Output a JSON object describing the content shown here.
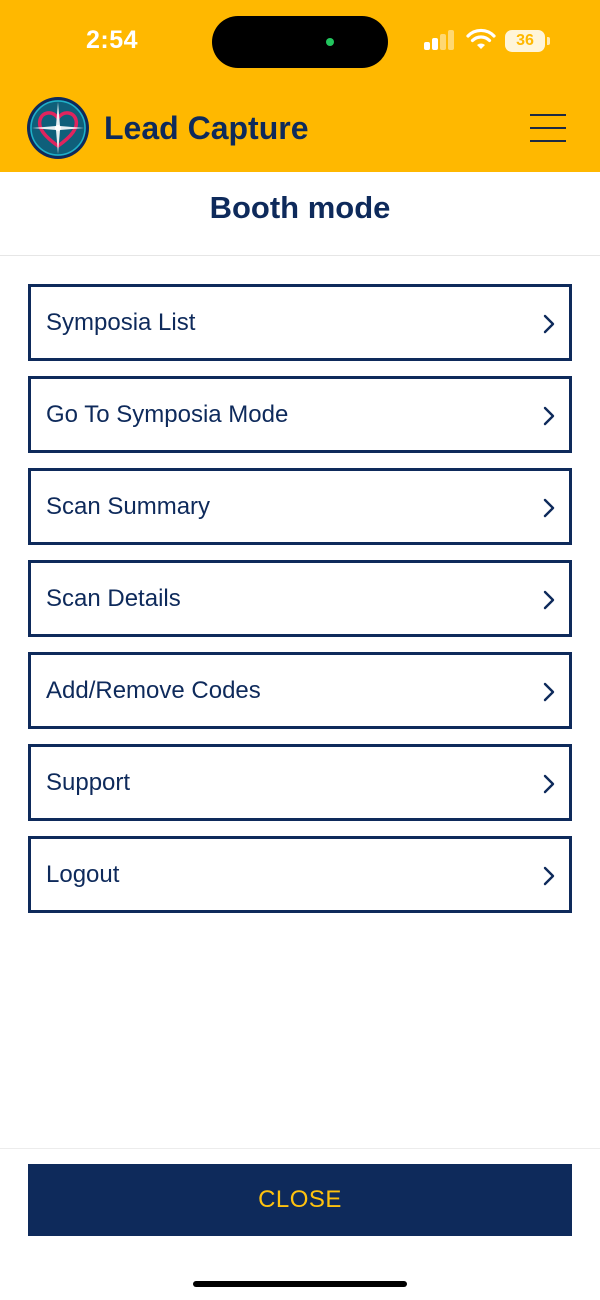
{
  "status_bar": {
    "time": "2:54",
    "battery": "36"
  },
  "header": {
    "app_title": "Lead Capture",
    "logo_icon": "heart-compass-logo",
    "menu_icon": "hamburger-menu-icon"
  },
  "page": {
    "title": "Booth mode"
  },
  "menu": {
    "items": [
      {
        "label": "Symposia List"
      },
      {
        "label": "Go To Symposia Mode"
      },
      {
        "label": "Scan Summary"
      },
      {
        "label": "Scan Details"
      },
      {
        "label": "Add/Remove Codes"
      },
      {
        "label": "Support"
      },
      {
        "label": "Logout"
      }
    ]
  },
  "footer": {
    "close_label": "CLOSE"
  },
  "colors": {
    "header_yellow": "#FFB800",
    "navy": "#0E2A5B",
    "close_text": "#FFC20E"
  }
}
